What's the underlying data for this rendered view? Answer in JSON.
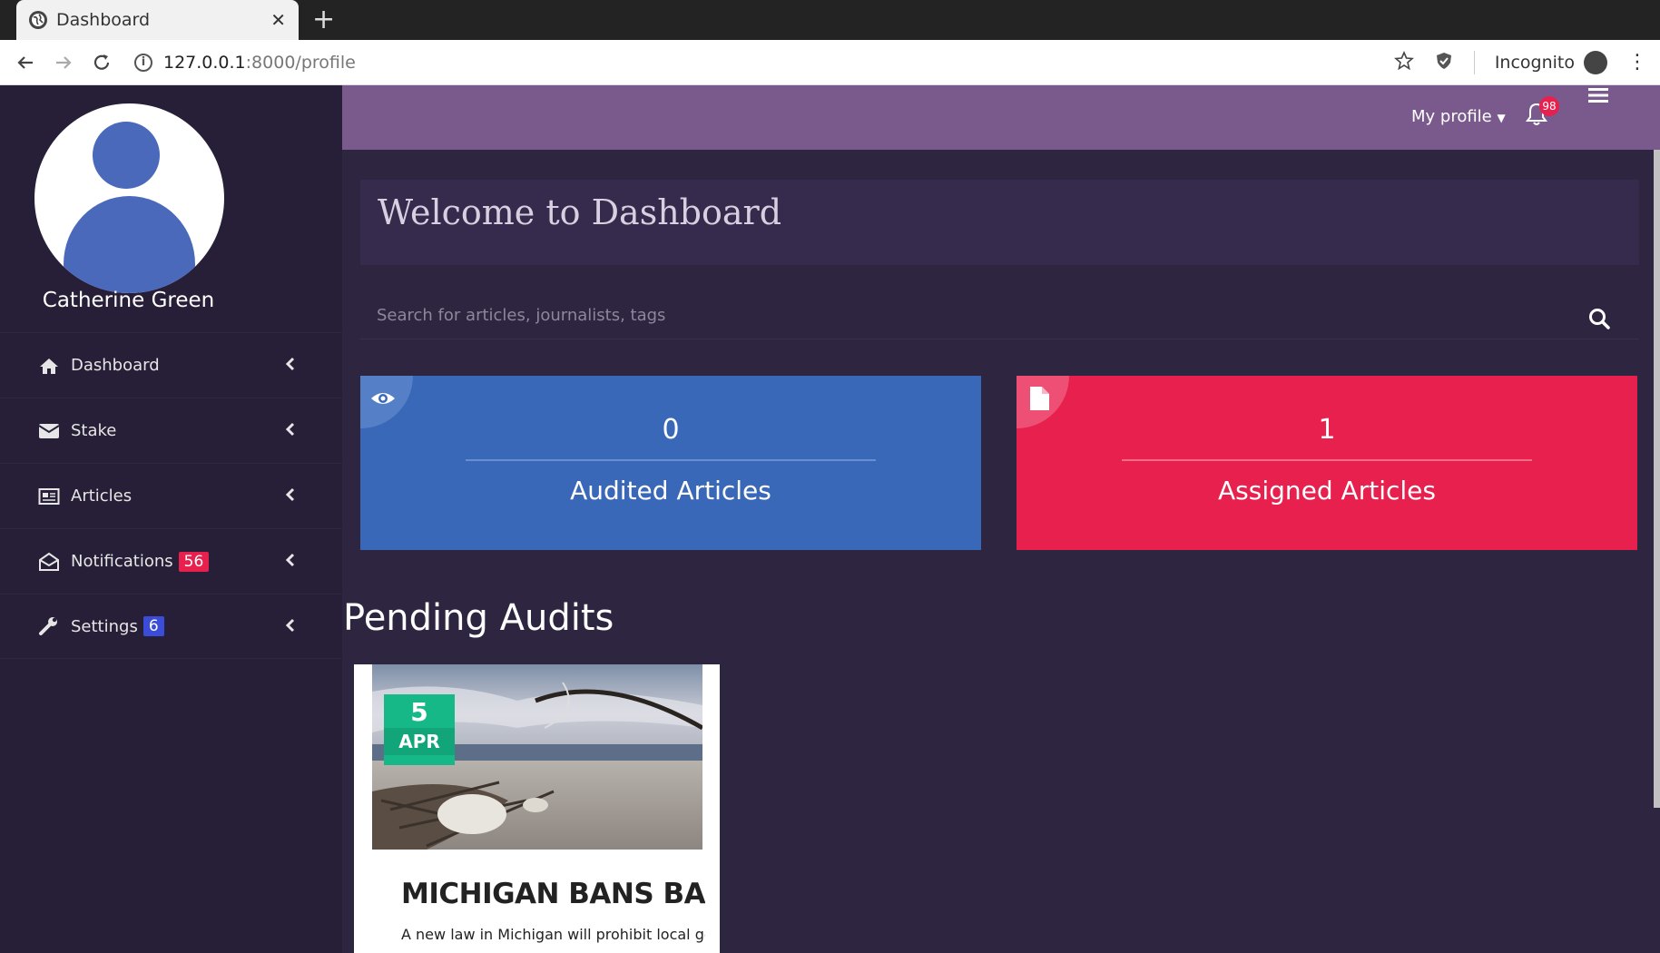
{
  "browser": {
    "tab_title": "Dashboard",
    "url_host": "127.0.0.1",
    "url_path": ":8000/profile",
    "incognito_label": "Incognito"
  },
  "user": {
    "name": "Catherine Green"
  },
  "sidebar": {
    "items": [
      {
        "label": "Dashboard",
        "icon": "home-icon"
      },
      {
        "label": "Stake",
        "icon": "envelope-icon"
      },
      {
        "label": "Articles",
        "icon": "newspaper-icon"
      },
      {
        "label": "Notifications",
        "icon": "envelope-open-icon",
        "badge": "56",
        "badge_color": "#e8204e"
      },
      {
        "label": "Settings",
        "icon": "wrench-icon",
        "badge": "6",
        "badge_color": "#3b4dd8"
      }
    ]
  },
  "topbar": {
    "profile_label": "My profile",
    "notification_count": "98"
  },
  "main": {
    "welcome": "Welcome to Dashboard",
    "search_placeholder": "Search for articles, journalists, tags",
    "stats": [
      {
        "value": "0",
        "label": "Audited Articles",
        "color": "#3a68b8",
        "icon": "eye-icon"
      },
      {
        "value": "1",
        "label": "Assigned Articles",
        "color": "#e8204e",
        "icon": "file-icon"
      }
    ],
    "pending_title": "Pending Audits",
    "article": {
      "day": "5",
      "month": "APR",
      "title": "MICHIGAN BANS BANNING PLASTIC BAGS",
      "description": "A new law in Michigan will prohibit local governments"
    }
  }
}
